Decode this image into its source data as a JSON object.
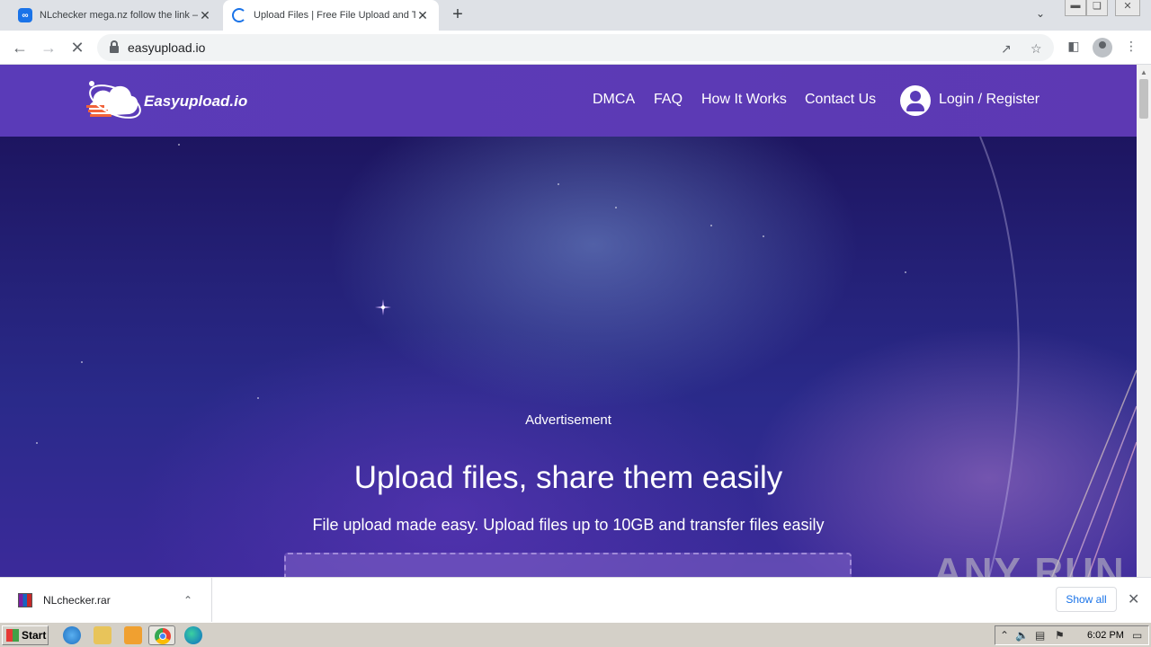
{
  "browser": {
    "tabs": [
      {
        "title": "NLchecker mega.nz follow the link —",
        "state": "inactive"
      },
      {
        "title": "Upload Files | Free File Upload and T",
        "state": "active-loading"
      }
    ],
    "new_tab_glyph": "+",
    "url": "easyupload.io",
    "window_controls": [
      "minimize-icon",
      "restore-icon",
      "close-icon"
    ]
  },
  "site": {
    "logo_text": "Easyupload.io",
    "nav": [
      "DMCA",
      "FAQ",
      "How It Works",
      "Contact Us"
    ],
    "login_label": "Login / Register",
    "colors": {
      "header": "#5a3bb8",
      "hero_dark": "#1d1560"
    }
  },
  "hero": {
    "ad_label": "Advertisement",
    "title": "Upload files, share them easily",
    "subtitle": "File upload made easy. Upload files up to 10GB and transfer files easily"
  },
  "downloads": {
    "file_name": "NLchecker.rar",
    "show_all": "Show all"
  },
  "taskbar": {
    "start_label": "Start",
    "clock": "6:02 PM"
  },
  "watermark": "ANY RUN"
}
